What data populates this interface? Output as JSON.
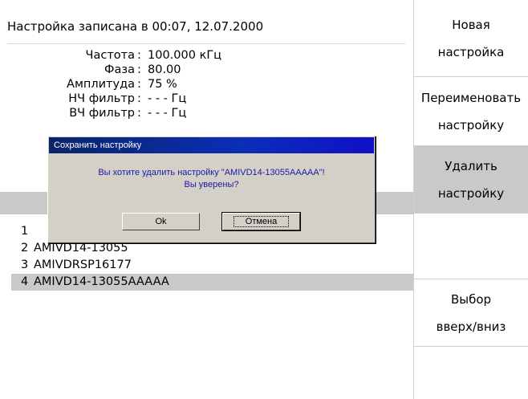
{
  "header": {
    "title": "Настройка записана в 00:07, 12.07.2000"
  },
  "params": [
    {
      "label": "Частота",
      "value": "100.000 кГц"
    },
    {
      "label": "Фаза",
      "value": "80.00"
    },
    {
      "label": "Амплитуда",
      "value": "75 %"
    },
    {
      "label": "НЧ фильтр",
      "value": "- - - Гц"
    },
    {
      "label": "ВЧ фильтр",
      "value": "- - - Гц"
    }
  ],
  "list": [
    {
      "num": "1",
      "name": ""
    },
    {
      "num": "2",
      "name": "AMIVD14-13055"
    },
    {
      "num": "3",
      "name": "AMIVDRSP16177"
    },
    {
      "num": "4",
      "name": "AMIVD14-13055AAAAA"
    }
  ],
  "softkeys": [
    {
      "line1": "Новая",
      "line2": "настройка"
    },
    {
      "line1": "Переименовать",
      "line2": "настройку"
    },
    {
      "line1": "Удалить",
      "line2": "настройку"
    },
    {
      "line1": "",
      "line2": ""
    },
    {
      "line1": "Выбор",
      "line2": "вверх/вниз"
    }
  ],
  "dialog": {
    "title": "Сохранить настройку",
    "message_line1": "Вы хотите удалить настройку \"AMIVD14-13055AAAAA\"!",
    "message_line2": "Вы уверены?",
    "ok_label": "Ok",
    "cancel_label": "Отмена"
  },
  "colors": {
    "selection": "#c9c9c9",
    "dialog_title": "#0a246a",
    "dialog_bg": "#d4d0c8"
  }
}
